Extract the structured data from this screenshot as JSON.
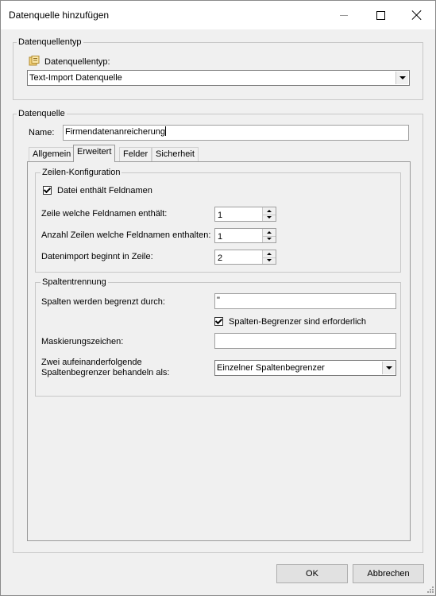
{
  "window": {
    "title": "Datenquelle hinzufügen"
  },
  "type_group": {
    "title": "Datenquellentyp",
    "field_label": "Datenquellentyp:",
    "selected": "Text-Import Datenquelle",
    "icon": "datasource-icon"
  },
  "source_group": {
    "title": "Datenquelle",
    "name_label": "Name:",
    "name_value": "Firmendatenanreicherung"
  },
  "tabs": [
    {
      "label": "Allgemein",
      "active": false
    },
    {
      "label": "Erweitert",
      "active": true
    },
    {
      "label": "Felder",
      "active": false
    },
    {
      "label": "Sicherheit",
      "active": false
    }
  ],
  "rows_config": {
    "title": "Zeilen-Konfiguration",
    "has_header_label": "Datei enthält Feldnamen",
    "has_header_checked": true,
    "header_row_label": "Zeile welche Feldnamen enthält:",
    "header_row_value": "1",
    "header_count_label": "Anzahl Zeilen welche Feldnamen enthalten:",
    "header_count_value": "1",
    "start_row_label": "Datenimport beginnt in Zeile:",
    "start_row_value": "2"
  },
  "columns_config": {
    "title": "Spaltentrennung",
    "delimiter_label": "Spalten werden begrenzt durch:",
    "delimiter_value": "\"",
    "delimiter_required_label": "Spalten-Begrenzer sind erforderlich",
    "delimiter_required_checked": true,
    "escape_label": "Maskierungszeichen:",
    "escape_value": "",
    "consecutive_label_line1": "Zwei aufeinanderfolgende",
    "consecutive_label_line2": "Spaltenbegrenzer behandeln als:",
    "consecutive_value": "Einzelner Spaltenbegrenzer"
  },
  "buttons": {
    "ok": "OK",
    "cancel": "Abbrechen"
  }
}
